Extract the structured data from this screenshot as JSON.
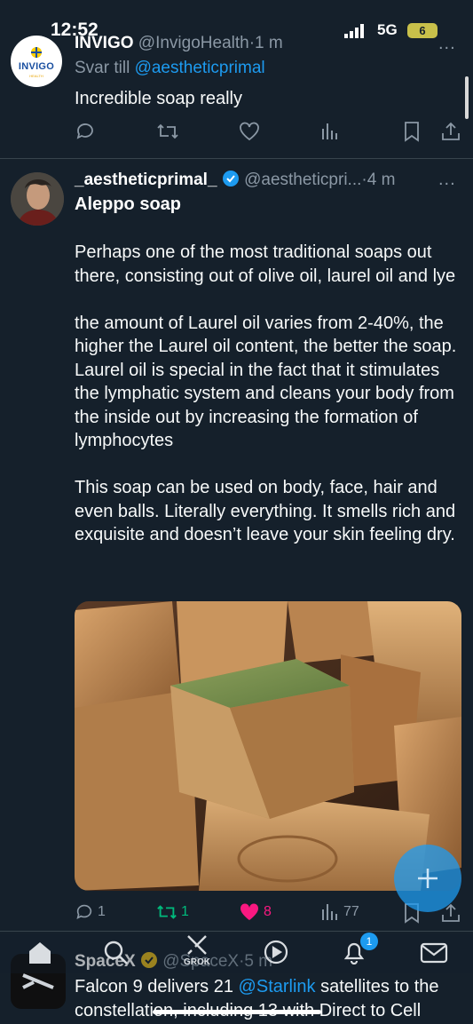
{
  "status_bar": {
    "time": "12:52",
    "network": "5G",
    "battery": "6"
  },
  "reply_tweet": {
    "avatar_brand": "INVIGO",
    "avatar_sub": "HEALTH",
    "name": "INVIGO",
    "handle": "@InvigoHealth",
    "time": "1 m",
    "reply_prefix": "Svar till",
    "reply_handle": "@aestheticprimal",
    "text": "Incredible soap really",
    "more": "..."
  },
  "main_tweet": {
    "name": "_aestheticprimal_",
    "handle": "@aestheticpri...",
    "time": "4 m",
    "title": "Aleppo soap",
    "paragraphs": [
      "Perhaps one of the most traditional soaps out there, consisting out of olive oil, laurel oil and lye",
      "the amount of Laurel oil varies from 2-40%, the higher the Laurel oil content, the better the soap. Laurel oil is special in the fact that it stimulates the lymphatic system and cleans your body from the inside out by increasing the formation of lymphocytes",
      "This soap can be used on body, face, hair and even balls.  Literally everything. It smells rich and exquisite and doesn’t leave your skin feeling dry."
    ],
    "stats": {
      "replies": "1",
      "reposts": "1",
      "likes": "8",
      "views": "77"
    },
    "more": "..."
  },
  "next_tweet": {
    "name": "SpaceX",
    "handle": "@SpaceX",
    "time": "5 m",
    "text_before": "Falcon 9 delivers 21 ",
    "mention": "@Starlink",
    "text_after": " satellites to the constellation, including 13 with Direct to Cell"
  },
  "bottom_nav": {
    "grok_label": "GROK",
    "notification_count": "1"
  },
  "colors": {
    "background": "#15202b",
    "accent": "#1d9bf0",
    "like": "#f91880",
    "repost": "#00ba7c",
    "muted": "#8b98a5"
  }
}
